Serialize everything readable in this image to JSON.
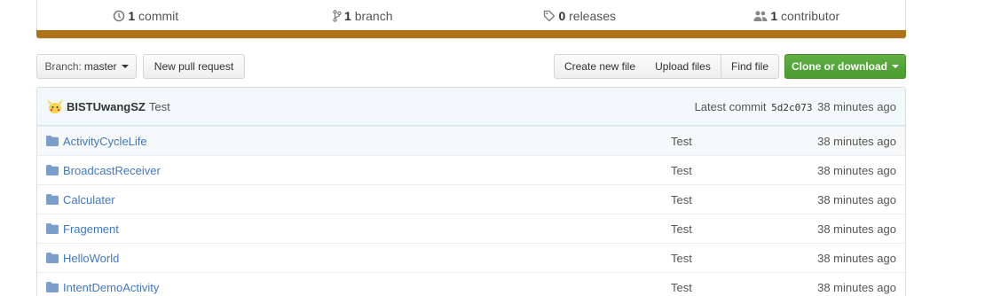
{
  "summary": {
    "commits": {
      "count": "1",
      "label": "commit"
    },
    "branches": {
      "count": "1",
      "label": "branch"
    },
    "releases": {
      "count": "0",
      "label": "releases"
    },
    "contributors": {
      "count": "1",
      "label": "contributor"
    },
    "language_color": "#b07219"
  },
  "toolbar": {
    "branch_prefix": "Branch:",
    "branch_name": "master",
    "new_pr": "New pull request",
    "create_file": "Create new file",
    "upload_files": "Upload files",
    "find_file": "Find file",
    "clone": "Clone or download"
  },
  "commit": {
    "author": "BISTUwangSZ",
    "message": "Test",
    "latest_label": "Latest commit",
    "sha": "5d2c073",
    "age": "38 minutes ago"
  },
  "files": [
    {
      "name": "ActivityCycleLife",
      "message": "Test",
      "age": "38 minutes ago",
      "icon": "folder-icon"
    },
    {
      "name": "BroadcastReceiver",
      "message": "Test",
      "age": "38 minutes ago",
      "icon": "folder-icon"
    },
    {
      "name": "Calculater",
      "message": "Test",
      "age": "38 minutes ago",
      "icon": "folder-icon"
    },
    {
      "name": "Fragement",
      "message": "Test",
      "age": "38 minutes ago",
      "icon": "folder-icon"
    },
    {
      "name": "HelloWorld",
      "message": "Test",
      "age": "38 minutes ago",
      "icon": "folder-icon"
    },
    {
      "name": "IntentDemoActivity",
      "message": "Test",
      "age": "38 minutes ago",
      "icon": "folder-icon"
    }
  ]
}
